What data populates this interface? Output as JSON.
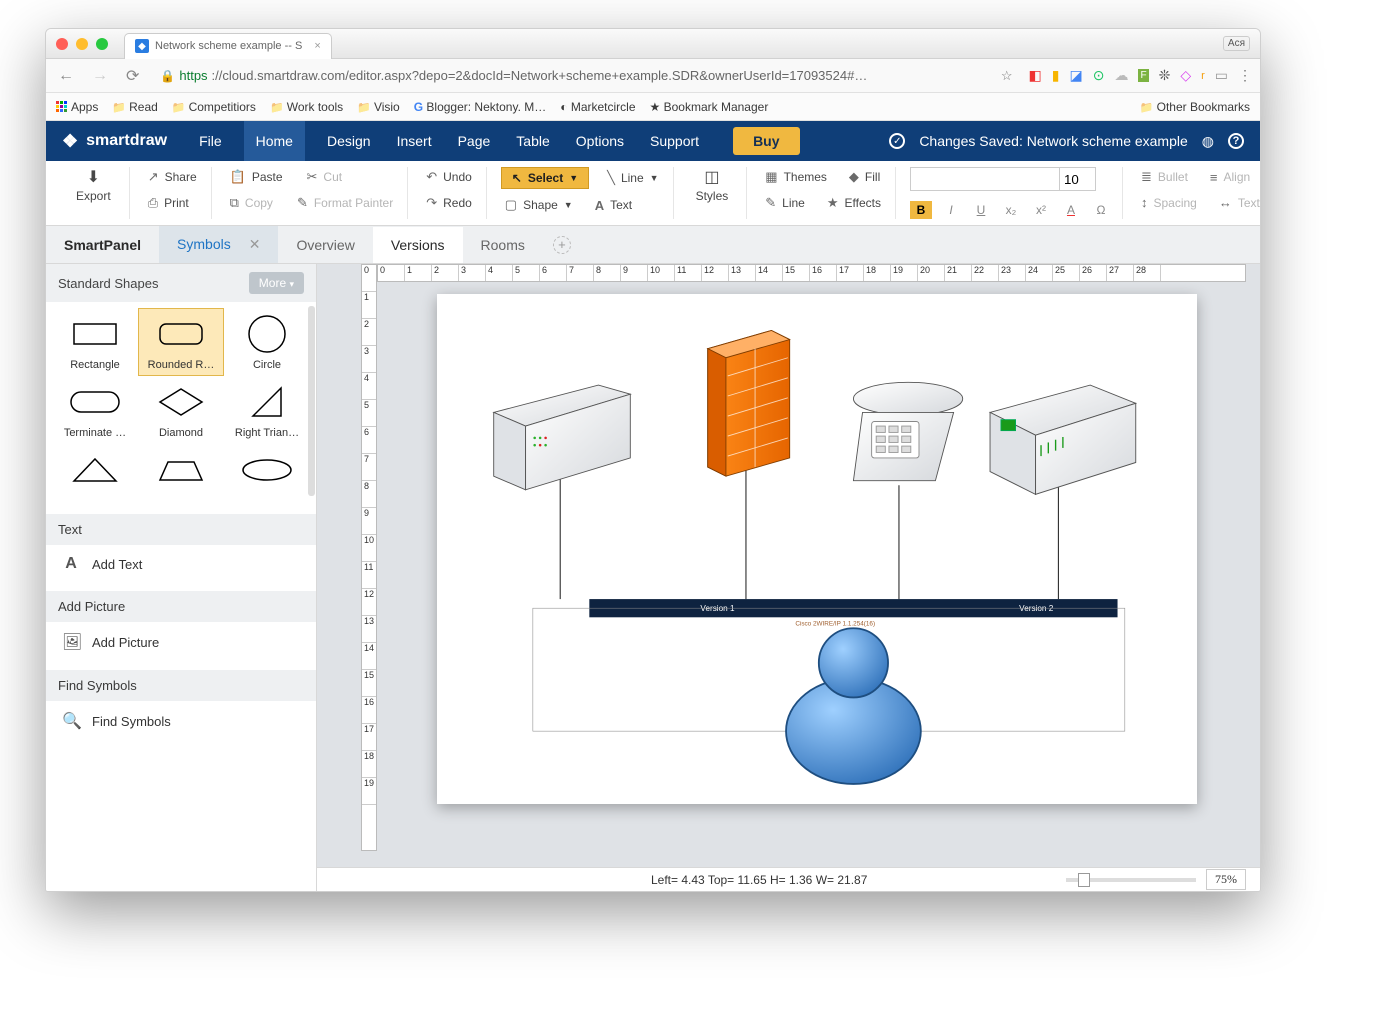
{
  "browser": {
    "tab_title": "Network scheme example -- S",
    "profile_badge": "Ася",
    "url_prefix": "https",
    "url_rest": "://cloud.smartdraw.com/editor.aspx?depo=2&docId=Network+scheme+example.SDR&ownerUserId=17093524#…",
    "bookmarks": {
      "apps": "Apps",
      "items": [
        "Read",
        "Competitiors",
        "Work tools",
        "Visio"
      ],
      "blogger": "Blogger: Nektony. M…",
      "marketcircle": "Marketcircle",
      "bookmark_manager": "Bookmark Manager",
      "other": "Other Bookmarks"
    }
  },
  "app": {
    "brand": "smartdraw",
    "menus": [
      "File",
      "Home",
      "Design",
      "Insert",
      "Page",
      "Table",
      "Options",
      "Support"
    ],
    "buy": "Buy",
    "saved": "Changes Saved: Network scheme example"
  },
  "ribbon": {
    "export": "Export",
    "share": "Share",
    "print": "Print",
    "paste": "Paste",
    "cut": "Cut",
    "copy": "Copy",
    "fmtpainter": "Format Painter",
    "undo": "Undo",
    "redo": "Redo",
    "select": "Select",
    "shape": "Shape",
    "line": "Line",
    "text": "Text",
    "styles": "Styles",
    "themes": "Themes",
    "fill": "Fill",
    "line2": "Line",
    "effects": "Effects",
    "fontsize": "10",
    "bullet": "Bullet",
    "align": "Align",
    "spacing": "Spacing",
    "textdir": "Text Directio"
  },
  "tabs": {
    "panel": "SmartPanel",
    "symbols": "Symbols",
    "overview": "Overview",
    "versions": "Versions",
    "rooms": "Rooms"
  },
  "smartpanel": {
    "standard_shapes": "Standard Shapes",
    "more": "More",
    "shapes": [
      "Rectangle",
      "Rounded R…",
      "Circle",
      "Terminate …",
      "Diamond",
      "Right Trian…"
    ],
    "text_head": "Text",
    "add_text": "Add Text",
    "pic_head": "Add Picture",
    "add_pic": "Add Picture",
    "find_head": "Find Symbols",
    "find": "Find Symbols"
  },
  "canvas": {
    "version1": "Version 1",
    "version2": "Version 2",
    "cisco": "Cisco 2WIRE/IP 1.1.254(16)"
  },
  "status": {
    "coords": "Left= 4.43 Top= 11.65 H= 1.36 W= 21.87",
    "zoom": "75%"
  }
}
